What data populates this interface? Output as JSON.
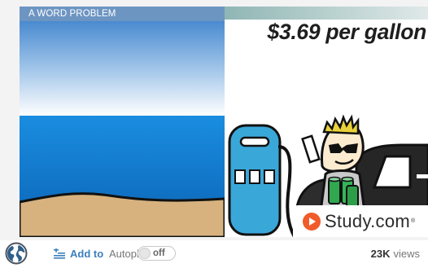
{
  "video": {
    "lesson_tag": "A WORD PROBLEM",
    "price_text": "$3.69 per gallon",
    "brand": {
      "name": "Study.com",
      "trademark": "®",
      "icon": "play-icon"
    }
  },
  "controls": {
    "add_label": "Add to",
    "autoplay_label": "Autoplay",
    "autoplay_state": "off",
    "views_count": "23K",
    "views_label": "views"
  },
  "icons": {
    "globe": "globe-icon",
    "add_to": "playlist-add-icon"
  },
  "colors": {
    "accent_blue": "#3d7fbc",
    "brand_orange": "#f15b2a",
    "pump_blue": "#3aa7d9",
    "sea_blue": "#1a86d6",
    "sand": "#d7b27e"
  }
}
